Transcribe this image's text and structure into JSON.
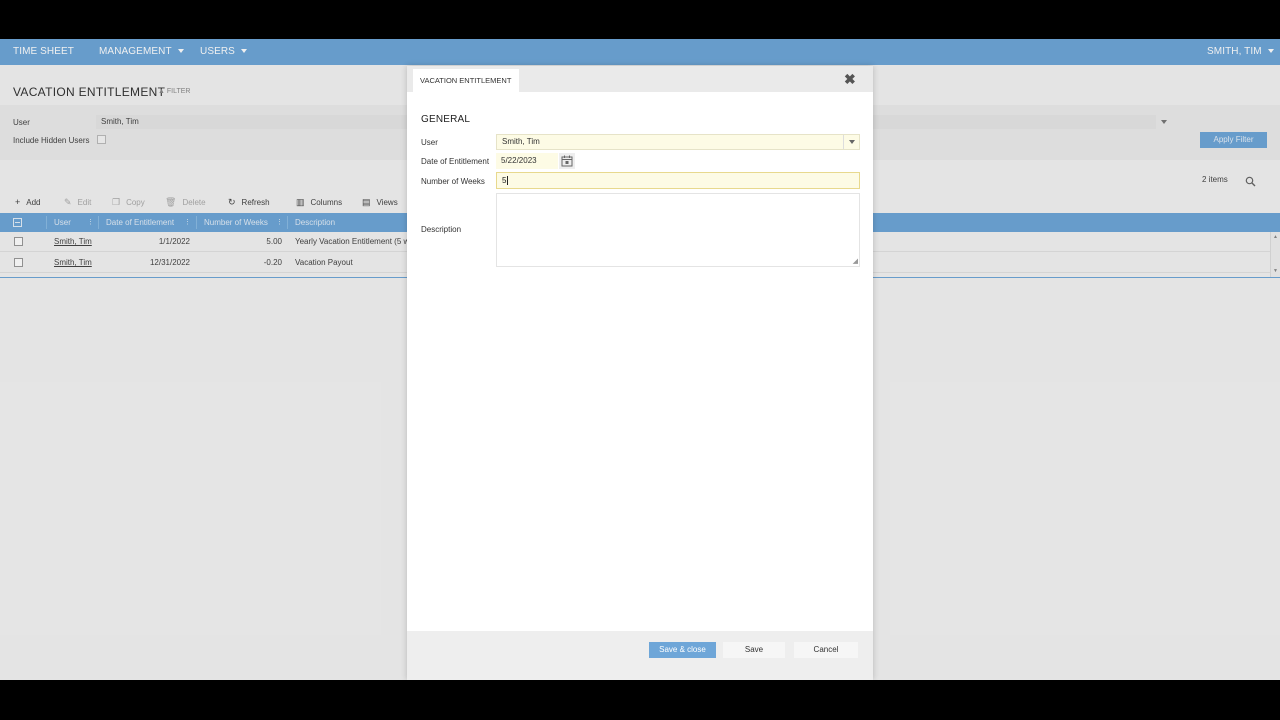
{
  "nav": {
    "time_sheet": "TIME SHEET",
    "management": "MANAGEMENT",
    "users": "USERS",
    "current_user": "SMITH, TIM"
  },
  "page": {
    "title": "VACATION ENTITLEMENT",
    "filter_toggle": "FILTER"
  },
  "filter": {
    "user_label": "User",
    "user_value": "Smith, Tim",
    "include_hidden_label": "Include Hidden Users",
    "apply_label": "Apply Filter"
  },
  "toolbar": {
    "add": "Add",
    "edit": "Edit",
    "copy": "Copy",
    "delete": "Delete",
    "refresh": "Refresh",
    "columns": "Columns",
    "views": "Views"
  },
  "grid": {
    "items_count": "2 items",
    "columns": [
      "User",
      "Date of Entitlement",
      "Number of Weeks",
      "Description"
    ],
    "rows": [
      {
        "user": "Smith, Tim",
        "date": "1/1/2022",
        "weeks": "5.00",
        "description": "Yearly Vacation Entitlement (5 w"
      },
      {
        "user": "Smith, Tim",
        "date": "12/31/2022",
        "weeks": "-0.20",
        "description": "Vacation Payout"
      }
    ]
  },
  "dialog": {
    "tab_title": "VACATION ENTITLEMENT",
    "section": "GENERAL",
    "user_label": "User",
    "user_value": "Smith, Tim",
    "date_label": "Date of Entitlement",
    "date_value": "5/22/2023",
    "weeks_label": "Number of Weeks",
    "weeks_value": "5",
    "description_label": "Description",
    "description_value": "",
    "save_close": "Save & close",
    "save": "Save",
    "cancel": "Cancel"
  },
  "icons": {
    "close": "close-icon",
    "calendar": "calendar-icon",
    "search": "search-icon"
  },
  "colors": {
    "accent": "#6ea6d8",
    "input_highlight": "#fdfbe5"
  }
}
